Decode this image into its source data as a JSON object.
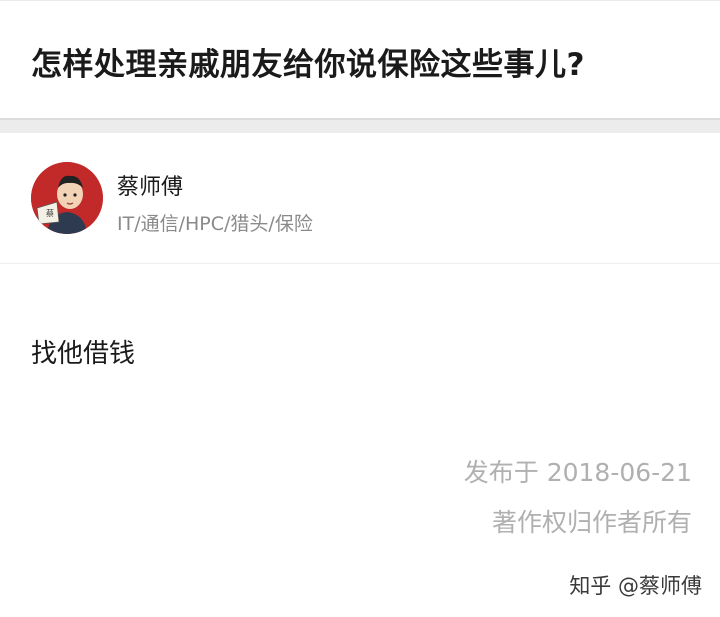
{
  "question": {
    "title": "怎样处理亲戚朋友给你说保险这些事儿?"
  },
  "author": {
    "name": "蔡师傅",
    "headline": "IT/通信/HPC/猎头/保险",
    "avatar_badge": "蔡",
    "avatar_bg_color": "#c22a2a"
  },
  "answer": {
    "content": "找他借钱",
    "published": "发布于 2018-06-21",
    "copyright": "著作权归作者所有"
  },
  "watermark": {
    "text": "知乎 @蔡师傅"
  }
}
